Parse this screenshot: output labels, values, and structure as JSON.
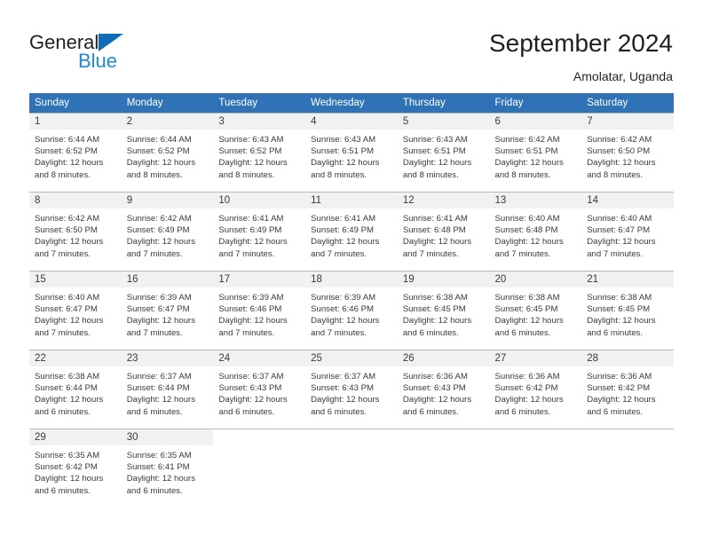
{
  "brand": {
    "name_top": "General",
    "name_bottom": "Blue",
    "color_top": "#231f20",
    "color_bottom": "#2089d4",
    "mark_color": "#0f6cb6"
  },
  "header": {
    "title": "September 2024",
    "subtitle": "Amolatar, Uganda"
  },
  "theme": {
    "header_bg": "#2f72b5",
    "header_text": "#ffffff",
    "daynum_bg": "#f1f1f1",
    "grid_line": "#b8b8b8",
    "body_text": "#3a3a3a"
  },
  "weekdays": [
    "Sunday",
    "Monday",
    "Tuesday",
    "Wednesday",
    "Thursday",
    "Friday",
    "Saturday"
  ],
  "weeks": [
    [
      {
        "day": "1",
        "sunrise": "Sunrise: 6:44 AM",
        "sunset": "Sunset: 6:52 PM",
        "daylight": "Daylight: 12 hours and 8 minutes."
      },
      {
        "day": "2",
        "sunrise": "Sunrise: 6:44 AM",
        "sunset": "Sunset: 6:52 PM",
        "daylight": "Daylight: 12 hours and 8 minutes."
      },
      {
        "day": "3",
        "sunrise": "Sunrise: 6:43 AM",
        "sunset": "Sunset: 6:52 PM",
        "daylight": "Daylight: 12 hours and 8 minutes."
      },
      {
        "day": "4",
        "sunrise": "Sunrise: 6:43 AM",
        "sunset": "Sunset: 6:51 PM",
        "daylight": "Daylight: 12 hours and 8 minutes."
      },
      {
        "day": "5",
        "sunrise": "Sunrise: 6:43 AM",
        "sunset": "Sunset: 6:51 PM",
        "daylight": "Daylight: 12 hours and 8 minutes."
      },
      {
        "day": "6",
        "sunrise": "Sunrise: 6:42 AM",
        "sunset": "Sunset: 6:51 PM",
        "daylight": "Daylight: 12 hours and 8 minutes."
      },
      {
        "day": "7",
        "sunrise": "Sunrise: 6:42 AM",
        "sunset": "Sunset: 6:50 PM",
        "daylight": "Daylight: 12 hours and 8 minutes."
      }
    ],
    [
      {
        "day": "8",
        "sunrise": "Sunrise: 6:42 AM",
        "sunset": "Sunset: 6:50 PM",
        "daylight": "Daylight: 12 hours and 7 minutes."
      },
      {
        "day": "9",
        "sunrise": "Sunrise: 6:42 AM",
        "sunset": "Sunset: 6:49 PM",
        "daylight": "Daylight: 12 hours and 7 minutes."
      },
      {
        "day": "10",
        "sunrise": "Sunrise: 6:41 AM",
        "sunset": "Sunset: 6:49 PM",
        "daylight": "Daylight: 12 hours and 7 minutes."
      },
      {
        "day": "11",
        "sunrise": "Sunrise: 6:41 AM",
        "sunset": "Sunset: 6:49 PM",
        "daylight": "Daylight: 12 hours and 7 minutes."
      },
      {
        "day": "12",
        "sunrise": "Sunrise: 6:41 AM",
        "sunset": "Sunset: 6:48 PM",
        "daylight": "Daylight: 12 hours and 7 minutes."
      },
      {
        "day": "13",
        "sunrise": "Sunrise: 6:40 AM",
        "sunset": "Sunset: 6:48 PM",
        "daylight": "Daylight: 12 hours and 7 minutes."
      },
      {
        "day": "14",
        "sunrise": "Sunrise: 6:40 AM",
        "sunset": "Sunset: 6:47 PM",
        "daylight": "Daylight: 12 hours and 7 minutes."
      }
    ],
    [
      {
        "day": "15",
        "sunrise": "Sunrise: 6:40 AM",
        "sunset": "Sunset: 6:47 PM",
        "daylight": "Daylight: 12 hours and 7 minutes."
      },
      {
        "day": "16",
        "sunrise": "Sunrise: 6:39 AM",
        "sunset": "Sunset: 6:47 PM",
        "daylight": "Daylight: 12 hours and 7 minutes."
      },
      {
        "day": "17",
        "sunrise": "Sunrise: 6:39 AM",
        "sunset": "Sunset: 6:46 PM",
        "daylight": "Daylight: 12 hours and 7 minutes."
      },
      {
        "day": "18",
        "sunrise": "Sunrise: 6:39 AM",
        "sunset": "Sunset: 6:46 PM",
        "daylight": "Daylight: 12 hours and 7 minutes."
      },
      {
        "day": "19",
        "sunrise": "Sunrise: 6:38 AM",
        "sunset": "Sunset: 6:45 PM",
        "daylight": "Daylight: 12 hours and 6 minutes."
      },
      {
        "day": "20",
        "sunrise": "Sunrise: 6:38 AM",
        "sunset": "Sunset: 6:45 PM",
        "daylight": "Daylight: 12 hours and 6 minutes."
      },
      {
        "day": "21",
        "sunrise": "Sunrise: 6:38 AM",
        "sunset": "Sunset: 6:45 PM",
        "daylight": "Daylight: 12 hours and 6 minutes."
      }
    ],
    [
      {
        "day": "22",
        "sunrise": "Sunrise: 6:38 AM",
        "sunset": "Sunset: 6:44 PM",
        "daylight": "Daylight: 12 hours and 6 minutes."
      },
      {
        "day": "23",
        "sunrise": "Sunrise: 6:37 AM",
        "sunset": "Sunset: 6:44 PM",
        "daylight": "Daylight: 12 hours and 6 minutes."
      },
      {
        "day": "24",
        "sunrise": "Sunrise: 6:37 AM",
        "sunset": "Sunset: 6:43 PM",
        "daylight": "Daylight: 12 hours and 6 minutes."
      },
      {
        "day": "25",
        "sunrise": "Sunrise: 6:37 AM",
        "sunset": "Sunset: 6:43 PM",
        "daylight": "Daylight: 12 hours and 6 minutes."
      },
      {
        "day": "26",
        "sunrise": "Sunrise: 6:36 AM",
        "sunset": "Sunset: 6:43 PM",
        "daylight": "Daylight: 12 hours and 6 minutes."
      },
      {
        "day": "27",
        "sunrise": "Sunrise: 6:36 AM",
        "sunset": "Sunset: 6:42 PM",
        "daylight": "Daylight: 12 hours and 6 minutes."
      },
      {
        "day": "28",
        "sunrise": "Sunrise: 6:36 AM",
        "sunset": "Sunset: 6:42 PM",
        "daylight": "Daylight: 12 hours and 6 minutes."
      }
    ],
    [
      {
        "day": "29",
        "sunrise": "Sunrise: 6:35 AM",
        "sunset": "Sunset: 6:42 PM",
        "daylight": "Daylight: 12 hours and 6 minutes."
      },
      {
        "day": "30",
        "sunrise": "Sunrise: 6:35 AM",
        "sunset": "Sunset: 6:41 PM",
        "daylight": "Daylight: 12 hours and 6 minutes."
      },
      {
        "day": "",
        "sunrise": "",
        "sunset": "",
        "daylight": ""
      },
      {
        "day": "",
        "sunrise": "",
        "sunset": "",
        "daylight": ""
      },
      {
        "day": "",
        "sunrise": "",
        "sunset": "",
        "daylight": ""
      },
      {
        "day": "",
        "sunrise": "",
        "sunset": "",
        "daylight": ""
      },
      {
        "day": "",
        "sunrise": "",
        "sunset": "",
        "daylight": ""
      }
    ]
  ]
}
